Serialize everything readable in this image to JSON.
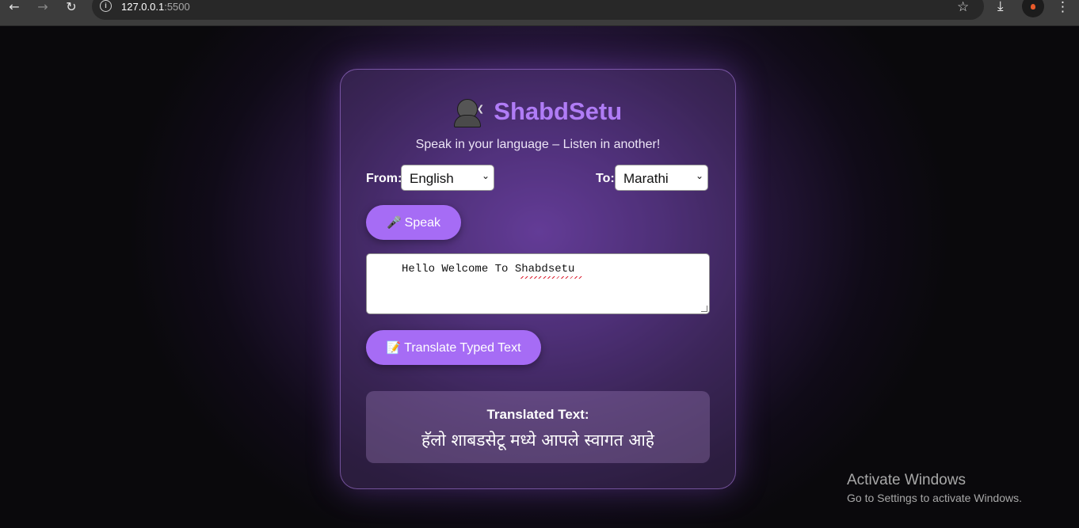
{
  "browser": {
    "url_host": "127.0.0.1",
    "url_port": ":5500",
    "back_icon": "arrow-left-icon",
    "forward_icon": "arrow-right-icon",
    "reload_icon": "reload-icon",
    "bookmark_icon": "star-icon",
    "download_icon": "download-icon",
    "menu_icon": "kebab-menu-icon"
  },
  "app": {
    "title": "ShabdSetu",
    "subtitle": "Speak in your language – Listen in another!",
    "title_color": "#b07cf6",
    "accent": "#a66cf5"
  },
  "languages": {
    "from_label": "From:",
    "from_value": "English",
    "to_label": "To:",
    "to_value": "Marathi"
  },
  "actions": {
    "speak_label": "Speak",
    "translate_label": "Translate Typed Text"
  },
  "input": {
    "value": "Hello Welcome To Shabdsetu"
  },
  "result": {
    "heading": "Translated Text:",
    "text": "हॅलो शाबडसेटू मध्ये आपले स्वागत आहे"
  },
  "os_watermark": {
    "line1": "Activate Windows",
    "line2": "Go to Settings to activate Windows."
  }
}
